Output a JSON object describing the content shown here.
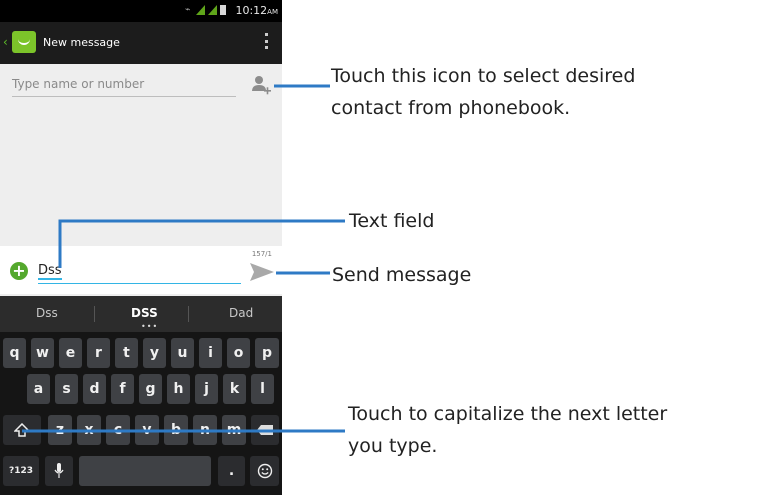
{
  "status_bar": {
    "time": "10:12",
    "ampm": "AM"
  },
  "action_bar": {
    "title": "New message"
  },
  "recipient": {
    "placeholder": "Type name or number"
  },
  "compose": {
    "text": "Dss",
    "char_counter": "157/1"
  },
  "suggestions": [
    "Dss",
    "DSS",
    "Dad"
  ],
  "keyboard": {
    "row1": [
      "q",
      "w",
      "e",
      "r",
      "t",
      "y",
      "u",
      "i",
      "o",
      "p"
    ],
    "row2": [
      "a",
      "s",
      "d",
      "f",
      "g",
      "h",
      "j",
      "k",
      "l"
    ],
    "row3": [
      "z",
      "x",
      "c",
      "v",
      "b",
      "n",
      "m"
    ],
    "shift_icon": "shift-arrow-icon",
    "delete_icon": "backspace-icon",
    "symbols_label": "?123",
    "period_label": ".",
    "mic_icon": "microphone-icon",
    "emoji_icon": "smiley-icon"
  },
  "annotations": {
    "contact_line1": "Touch this icon to select desired",
    "contact_line2": "contact from phonebook.",
    "text_field": "Text field",
    "send": "Send message",
    "shift_line1": "Touch to capitalize the next letter",
    "shift_line2": "you type."
  },
  "colors": {
    "callout_line": "#2e7ac5",
    "accent_blue": "#33b5e5",
    "green": "#5fa51a"
  }
}
